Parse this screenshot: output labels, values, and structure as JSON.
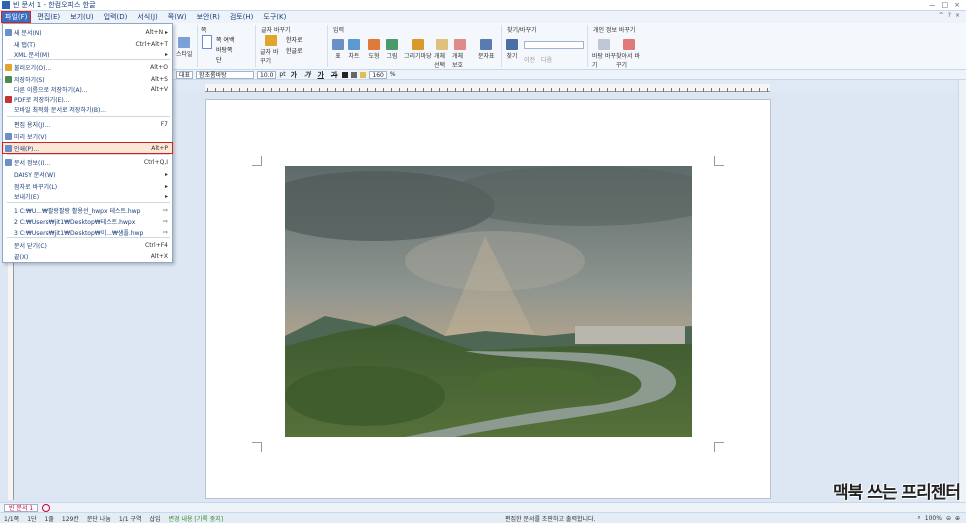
{
  "window": {
    "title": "빈 문서 1 - 한컴오피스 한글",
    "controls": [
      "ㅡ",
      "□",
      "×"
    ]
  },
  "menubar": {
    "items": [
      "파일(F)",
      "편집(E)",
      "보기(U)",
      "입력(D)",
      "서식(J)",
      "쪽(W)",
      "보안(R)",
      "검토(H)",
      "도구(K)"
    ],
    "right": [
      "^",
      "?",
      "×"
    ]
  },
  "ribbon": {
    "page_group": {
      "label": "쪽",
      "items": [
        "쪽 여백",
        "바탕쪽",
        "단"
      ]
    },
    "style_label": "스타일",
    "char_group": {
      "label": "글자 바꾸기",
      "items": [
        "글자 바꾸기",
        "한자로",
        "한글로"
      ]
    },
    "input_group": {
      "label": "입력",
      "items": [
        "표",
        "차트",
        "도형",
        "그림",
        "그리기마당",
        "개체 선택",
        "개체 보호",
        "문자표"
      ]
    },
    "find_group": {
      "label": "찾기/바꾸기",
      "items": [
        "찾기",
        "이전",
        "다음"
      ]
    },
    "personal_group": {
      "label": "개인 정보 바꾸기",
      "items": [
        "바탕 바꾸기",
        "찾아서 바꾸기"
      ]
    }
  },
  "formatbar": {
    "style": "대표",
    "font": "함초롬바탕",
    "size": "10.0",
    "unit": "pt",
    "zoom": "160",
    "zoom_unit": "%",
    "bold": "가",
    "italic": "가",
    "underline": "가",
    "strike": "가"
  },
  "file_menu": {
    "items": [
      {
        "label": "새 문서(N)",
        "shortcut": "Alt+N",
        "arrow": "▸",
        "icon_color": "#6b8fc7"
      },
      {
        "label": "새 탭(T)",
        "shortcut": "Ctrl+Alt+T",
        "icon_color": ""
      },
      {
        "label": "XML 문서(M)",
        "shortcut": "",
        "arrow": "▸",
        "icon_color": ""
      },
      {
        "label": "불러오기(O)...",
        "shortcut": "Alt+O",
        "icon_color": "#e0a52a"
      },
      {
        "label": "저장하기(S)",
        "shortcut": "Alt+S",
        "icon_color": "#4a8a4a"
      },
      {
        "label": "다른 이름으로 저장하기(A)...",
        "shortcut": "Alt+V",
        "icon_color": ""
      },
      {
        "label": "PDF로 저장하기(E)...",
        "shortcut": "",
        "icon_color": "#c83232"
      },
      {
        "label": "모바일 최적화 문서로 저장하기(B)...",
        "shortcut": "",
        "icon_color": ""
      },
      {
        "label": "편집 용지(J)...",
        "shortcut": "F7",
        "icon_color": ""
      },
      {
        "label": "미리 보기(V)",
        "shortcut": "",
        "icon_color": "#6b8fc7"
      },
      {
        "label": "인쇄(P)...",
        "shortcut": "Alt+P",
        "icon_color": "#6b8fc7",
        "selected": true
      },
      {
        "label": "문서 정보(I)...",
        "shortcut": "Ctrl+Q,I",
        "icon_color": "#6b8fc7"
      },
      {
        "label": "DAISY 문서(W)",
        "shortcut": "",
        "arrow": "▸",
        "icon_color": ""
      },
      {
        "label": "점자로 바꾸기(L)",
        "shortcut": "",
        "arrow": "▸",
        "icon_color": ""
      },
      {
        "label": "보내기(E)",
        "shortcut": "",
        "arrow": "▸",
        "icon_color": ""
      },
      {
        "label": "1 C:₩U...₩팔랑팔랑 활용선_hwpx 테스트.hwp",
        "shortcut": "",
        "arrow": "⇨",
        "icon_color": ""
      },
      {
        "label": "2 C:₩Users₩jit1₩Desktop₩테스트.hwpx",
        "shortcut": "",
        "arrow": "⇨",
        "icon_color": ""
      },
      {
        "label": "3 C:₩Users₩jit1₩Desktop₩이...₩샘플.hwp",
        "shortcut": "",
        "arrow": "⇨",
        "icon_color": ""
      },
      {
        "label": "문서 닫기(C)",
        "shortcut": "Ctrl+F4",
        "icon_color": ""
      },
      {
        "label": "끝(X)",
        "shortcut": "Alt+X",
        "icon_color": ""
      }
    ]
  },
  "document": {
    "image_alt": "구름 낀 하늘 아래 강과 녹지, 아파트 풍경 사진"
  },
  "tabbar": {
    "doc_tab": "빈 문서 1"
  },
  "statusbar": {
    "page": "1/1쪽",
    "line": "1단",
    "col": "1줄",
    "chars": "129칸",
    "section": "문단 나눔",
    "block": "1/1 구역",
    "mode": "삽입",
    "track": "변경 내용 [기록 중지]",
    "message": "편집한 문서를 조판하고 출력합니다.",
    "zoom": "100%"
  },
  "watermark": {
    "text": "맥북 쓰는 프리젠터"
  },
  "colors": {
    "accent": "#3d6fc1",
    "highlight_border": "#d42020",
    "page_bg": "#ffffff",
    "app_bg": "#dde7f3"
  }
}
